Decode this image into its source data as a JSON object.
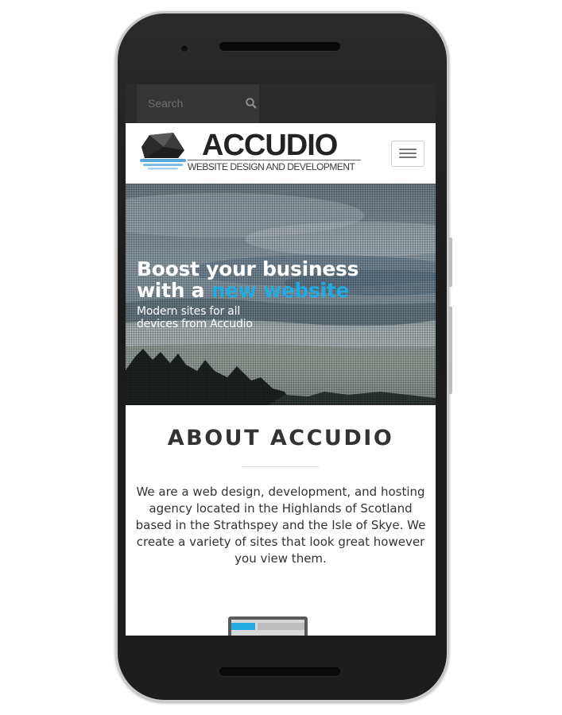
{
  "search": {
    "placeholder": "Search"
  },
  "logo": {
    "title": "ACCUDIO",
    "subtitle": "WEBSITE DESIGN AND DEVELOPMENT"
  },
  "hero": {
    "headline_line1": "Boost your business",
    "headline_line2_prefix": "with a ",
    "headline_line2_accent": "new website",
    "subtitle_line1": "Modern sites for all",
    "subtitle_line2": "devices from Accudio"
  },
  "about": {
    "title": "ABOUT ACCUDIO",
    "body": "We are a web design, development, and hosting agency located in the Highlands of Scotland based in the Strathspey and the Isle of Skye. We create a variety of sites that look great however you view them."
  },
  "colors": {
    "accent": "#22a9e0",
    "topbar": "#2a2a2a",
    "text": "#333333"
  },
  "icons": {
    "search": "search-icon",
    "menu": "hamburger-menu-icon",
    "logo": "accudio-logo-icon"
  }
}
